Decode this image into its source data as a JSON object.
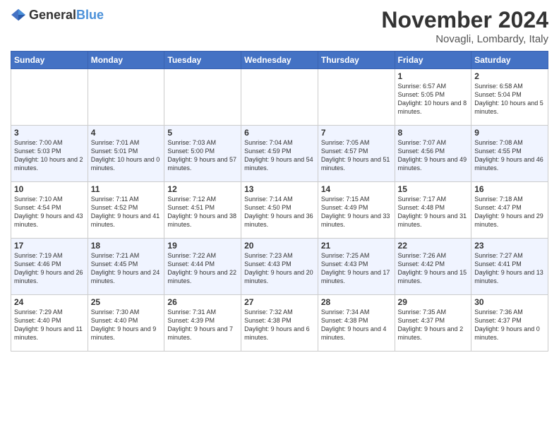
{
  "header": {
    "logo": {
      "text_general": "General",
      "text_blue": "Blue"
    },
    "title": "November 2024",
    "location": "Novagli, Lombardy, Italy"
  },
  "weekdays": [
    "Sunday",
    "Monday",
    "Tuesday",
    "Wednesday",
    "Thursday",
    "Friday",
    "Saturday"
  ],
  "weeks": [
    [
      {
        "day": "",
        "info": ""
      },
      {
        "day": "",
        "info": ""
      },
      {
        "day": "",
        "info": ""
      },
      {
        "day": "",
        "info": ""
      },
      {
        "day": "",
        "info": ""
      },
      {
        "day": "1",
        "info": "Sunrise: 6:57 AM\nSunset: 5:05 PM\nDaylight: 10 hours and 8 minutes."
      },
      {
        "day": "2",
        "info": "Sunrise: 6:58 AM\nSunset: 5:04 PM\nDaylight: 10 hours and 5 minutes."
      }
    ],
    [
      {
        "day": "3",
        "info": "Sunrise: 7:00 AM\nSunset: 5:03 PM\nDaylight: 10 hours and 2 minutes."
      },
      {
        "day": "4",
        "info": "Sunrise: 7:01 AM\nSunset: 5:01 PM\nDaylight: 10 hours and 0 minutes."
      },
      {
        "day": "5",
        "info": "Sunrise: 7:03 AM\nSunset: 5:00 PM\nDaylight: 9 hours and 57 minutes."
      },
      {
        "day": "6",
        "info": "Sunrise: 7:04 AM\nSunset: 4:59 PM\nDaylight: 9 hours and 54 minutes."
      },
      {
        "day": "7",
        "info": "Sunrise: 7:05 AM\nSunset: 4:57 PM\nDaylight: 9 hours and 51 minutes."
      },
      {
        "day": "8",
        "info": "Sunrise: 7:07 AM\nSunset: 4:56 PM\nDaylight: 9 hours and 49 minutes."
      },
      {
        "day": "9",
        "info": "Sunrise: 7:08 AM\nSunset: 4:55 PM\nDaylight: 9 hours and 46 minutes."
      }
    ],
    [
      {
        "day": "10",
        "info": "Sunrise: 7:10 AM\nSunset: 4:54 PM\nDaylight: 9 hours and 43 minutes."
      },
      {
        "day": "11",
        "info": "Sunrise: 7:11 AM\nSunset: 4:52 PM\nDaylight: 9 hours and 41 minutes."
      },
      {
        "day": "12",
        "info": "Sunrise: 7:12 AM\nSunset: 4:51 PM\nDaylight: 9 hours and 38 minutes."
      },
      {
        "day": "13",
        "info": "Sunrise: 7:14 AM\nSunset: 4:50 PM\nDaylight: 9 hours and 36 minutes."
      },
      {
        "day": "14",
        "info": "Sunrise: 7:15 AM\nSunset: 4:49 PM\nDaylight: 9 hours and 33 minutes."
      },
      {
        "day": "15",
        "info": "Sunrise: 7:17 AM\nSunset: 4:48 PM\nDaylight: 9 hours and 31 minutes."
      },
      {
        "day": "16",
        "info": "Sunrise: 7:18 AM\nSunset: 4:47 PM\nDaylight: 9 hours and 29 minutes."
      }
    ],
    [
      {
        "day": "17",
        "info": "Sunrise: 7:19 AM\nSunset: 4:46 PM\nDaylight: 9 hours and 26 minutes."
      },
      {
        "day": "18",
        "info": "Sunrise: 7:21 AM\nSunset: 4:45 PM\nDaylight: 9 hours and 24 minutes."
      },
      {
        "day": "19",
        "info": "Sunrise: 7:22 AM\nSunset: 4:44 PM\nDaylight: 9 hours and 22 minutes."
      },
      {
        "day": "20",
        "info": "Sunrise: 7:23 AM\nSunset: 4:43 PM\nDaylight: 9 hours and 20 minutes."
      },
      {
        "day": "21",
        "info": "Sunrise: 7:25 AM\nSunset: 4:43 PM\nDaylight: 9 hours and 17 minutes."
      },
      {
        "day": "22",
        "info": "Sunrise: 7:26 AM\nSunset: 4:42 PM\nDaylight: 9 hours and 15 minutes."
      },
      {
        "day": "23",
        "info": "Sunrise: 7:27 AM\nSunset: 4:41 PM\nDaylight: 9 hours and 13 minutes."
      }
    ],
    [
      {
        "day": "24",
        "info": "Sunrise: 7:29 AM\nSunset: 4:40 PM\nDaylight: 9 hours and 11 minutes."
      },
      {
        "day": "25",
        "info": "Sunrise: 7:30 AM\nSunset: 4:40 PM\nDaylight: 9 hours and 9 minutes."
      },
      {
        "day": "26",
        "info": "Sunrise: 7:31 AM\nSunset: 4:39 PM\nDaylight: 9 hours and 7 minutes."
      },
      {
        "day": "27",
        "info": "Sunrise: 7:32 AM\nSunset: 4:38 PM\nDaylight: 9 hours and 6 minutes."
      },
      {
        "day": "28",
        "info": "Sunrise: 7:34 AM\nSunset: 4:38 PM\nDaylight: 9 hours and 4 minutes."
      },
      {
        "day": "29",
        "info": "Sunrise: 7:35 AM\nSunset: 4:37 PM\nDaylight: 9 hours and 2 minutes."
      },
      {
        "day": "30",
        "info": "Sunrise: 7:36 AM\nSunset: 4:37 PM\nDaylight: 9 hours and 0 minutes."
      }
    ]
  ]
}
